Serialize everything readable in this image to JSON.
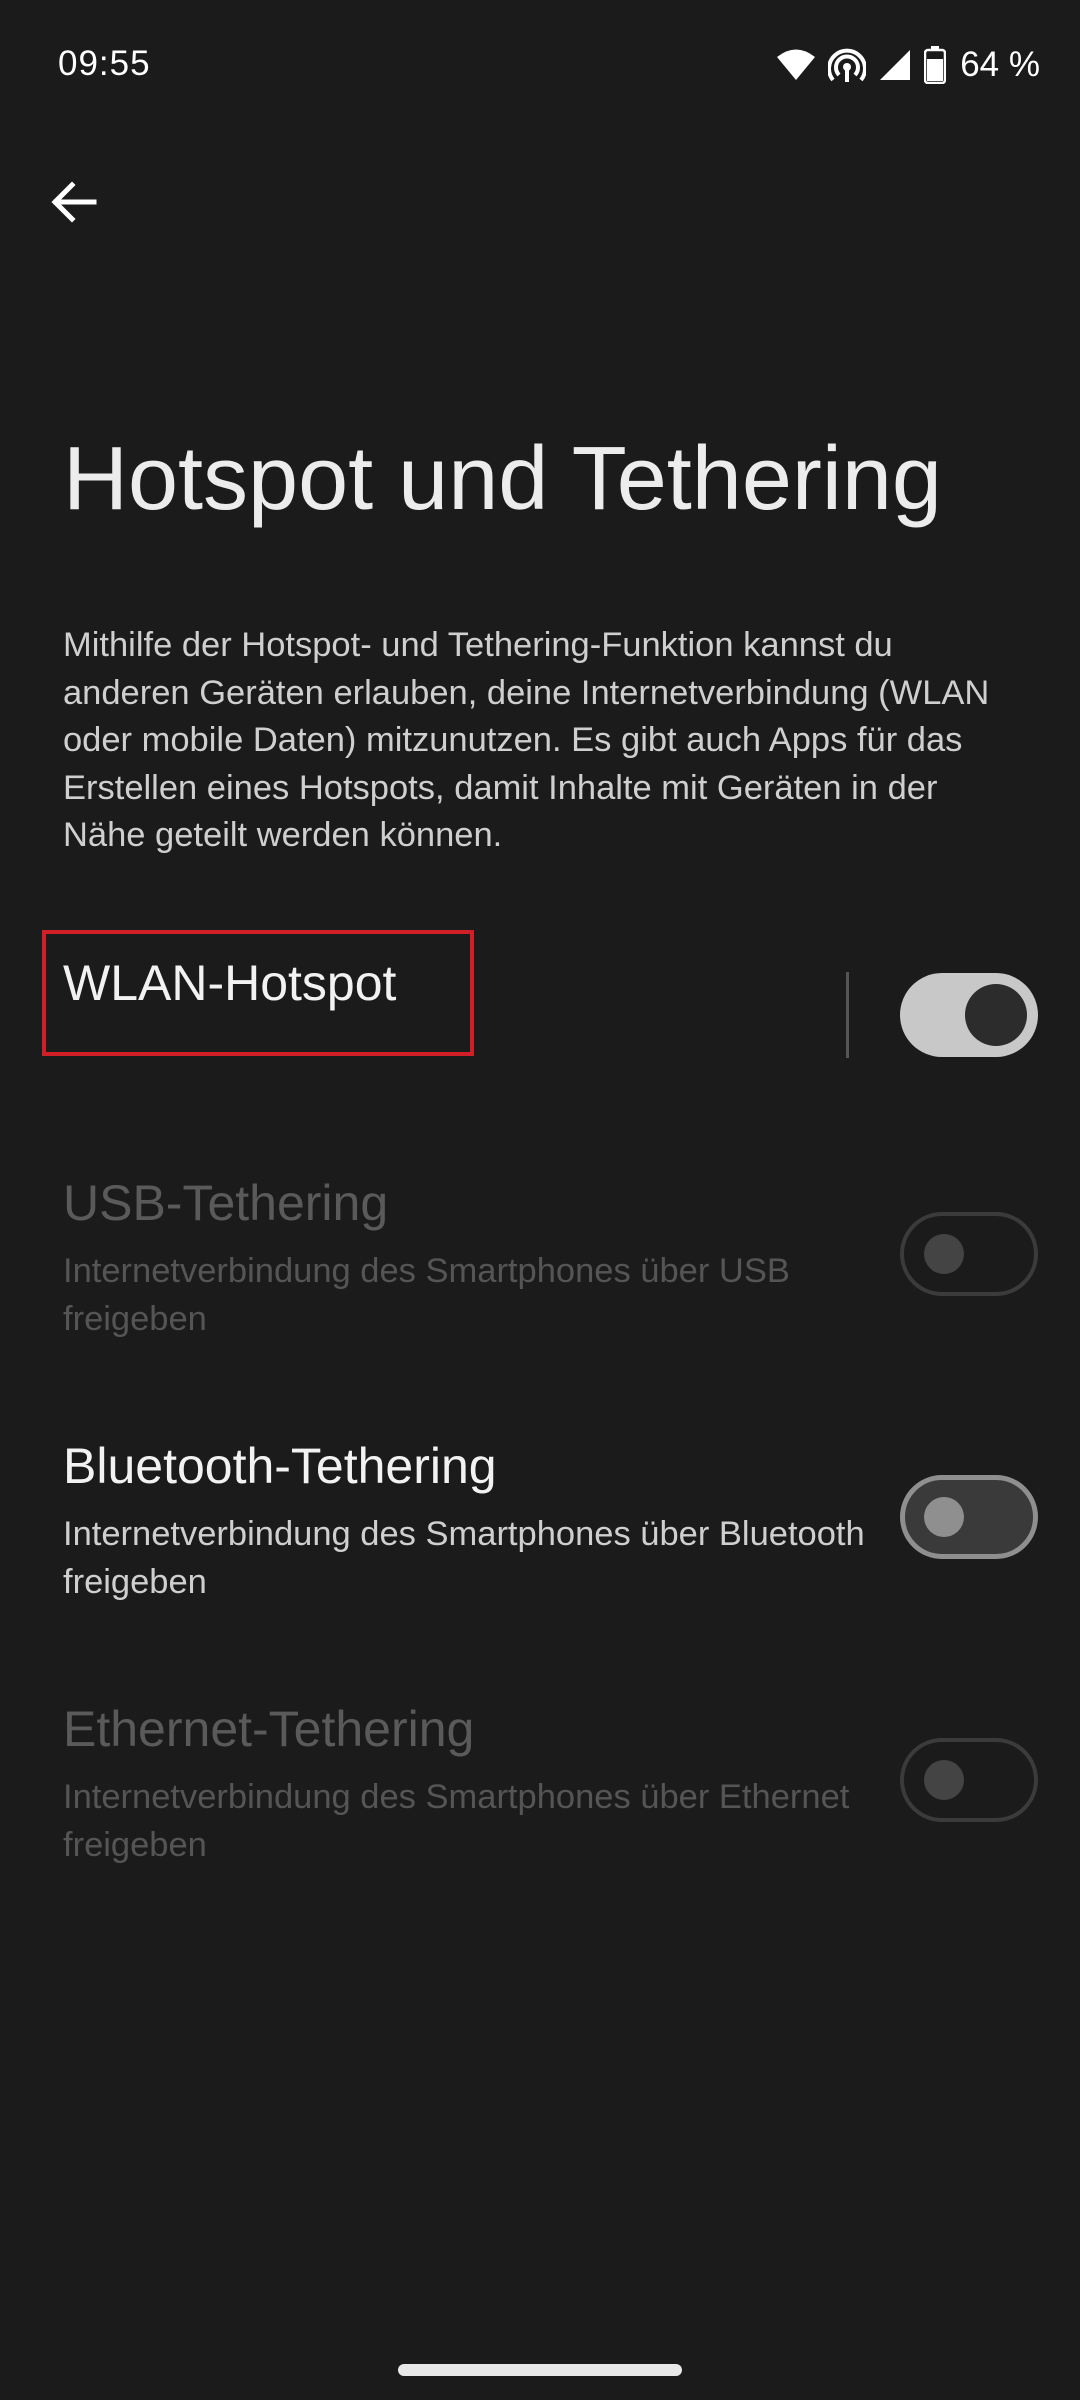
{
  "status_bar": {
    "time": "09:55",
    "battery_text": "64 %",
    "icons": [
      "wifi-icon",
      "hotspot-icon",
      "cell-signal-icon",
      "battery-icon"
    ]
  },
  "header": {
    "back_icon": "arrow-back-icon",
    "title": "Hotspot und Tethering",
    "description": "Mithilfe der Hotspot- und Tethering-Funktion kannst du anderen Geräten erlauben, deine Internetverbindung (WLAN oder mobile Daten) mitzunutzen. Es gibt auch Apps für das Erstellen eines Hotspots, damit Inhalte mit Geräten in der Nähe geteilt werden können."
  },
  "settings": [
    {
      "title": "WLAN-Hotspot",
      "subtitle": "",
      "state": "on",
      "enabled": true,
      "highlighted": true
    },
    {
      "title": "USB-Tethering",
      "subtitle": "Internetverbindung des Smartphones über USB freigeben",
      "state": "off",
      "enabled": false
    },
    {
      "title": "Bluetooth-Tethering",
      "subtitle": "Internetverbindung des Smartphones über Bluetooth freigeben",
      "state": "off",
      "enabled": true
    },
    {
      "title": "Ethernet-Tethering",
      "subtitle": "Internetverbindung des Smartphones über Ethernet freigeben",
      "state": "off",
      "enabled": false
    }
  ],
  "colors": {
    "background": "#1b1b1b",
    "highlight_box": "#d11f28",
    "toggle_on_track": "#c8c8c8"
  }
}
